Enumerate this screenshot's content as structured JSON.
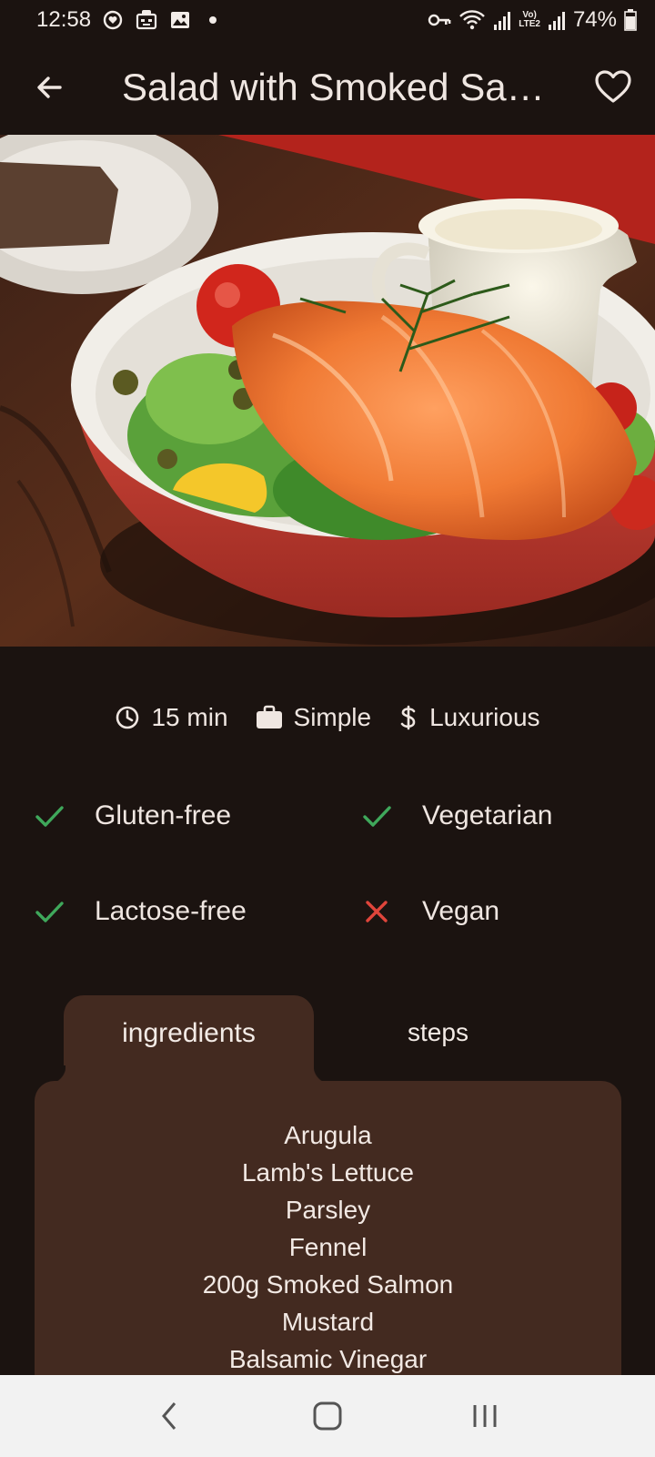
{
  "status_bar": {
    "time": "12:58",
    "battery": "74%",
    "lte_top": "Vo)",
    "lte_bottom": "LTE2"
  },
  "app_bar": {
    "title": "Salad with Smoked Salmon",
    "back_icon": "arrow-left-icon",
    "favorite_icon": "heart-outline-icon"
  },
  "hero": {
    "subject": "smoked salmon salad in a white bowl with a small cream jug"
  },
  "meta": {
    "duration": "15 min",
    "complexity": "Simple",
    "affordability": "Luxurious"
  },
  "diet": [
    {
      "label": "Gluten-free",
      "value": true
    },
    {
      "label": "Vegetarian",
      "value": true
    },
    {
      "label": "Lactose-free",
      "value": true
    },
    {
      "label": "Vegan",
      "value": false
    }
  ],
  "tabs": {
    "ingredients": "ingredients",
    "steps": "steps"
  },
  "ingredients": [
    "Arugula",
    "Lamb's Lettuce",
    "Parsley",
    "Fennel",
    "200g Smoked Salmon",
    "Mustard",
    "Balsamic Vinegar"
  ],
  "colors": {
    "background": "#1b1310",
    "panel": "#432a20",
    "check": "#3fa85b",
    "cross": "#e0453b",
    "nav_bar": "#f2f2f2"
  }
}
